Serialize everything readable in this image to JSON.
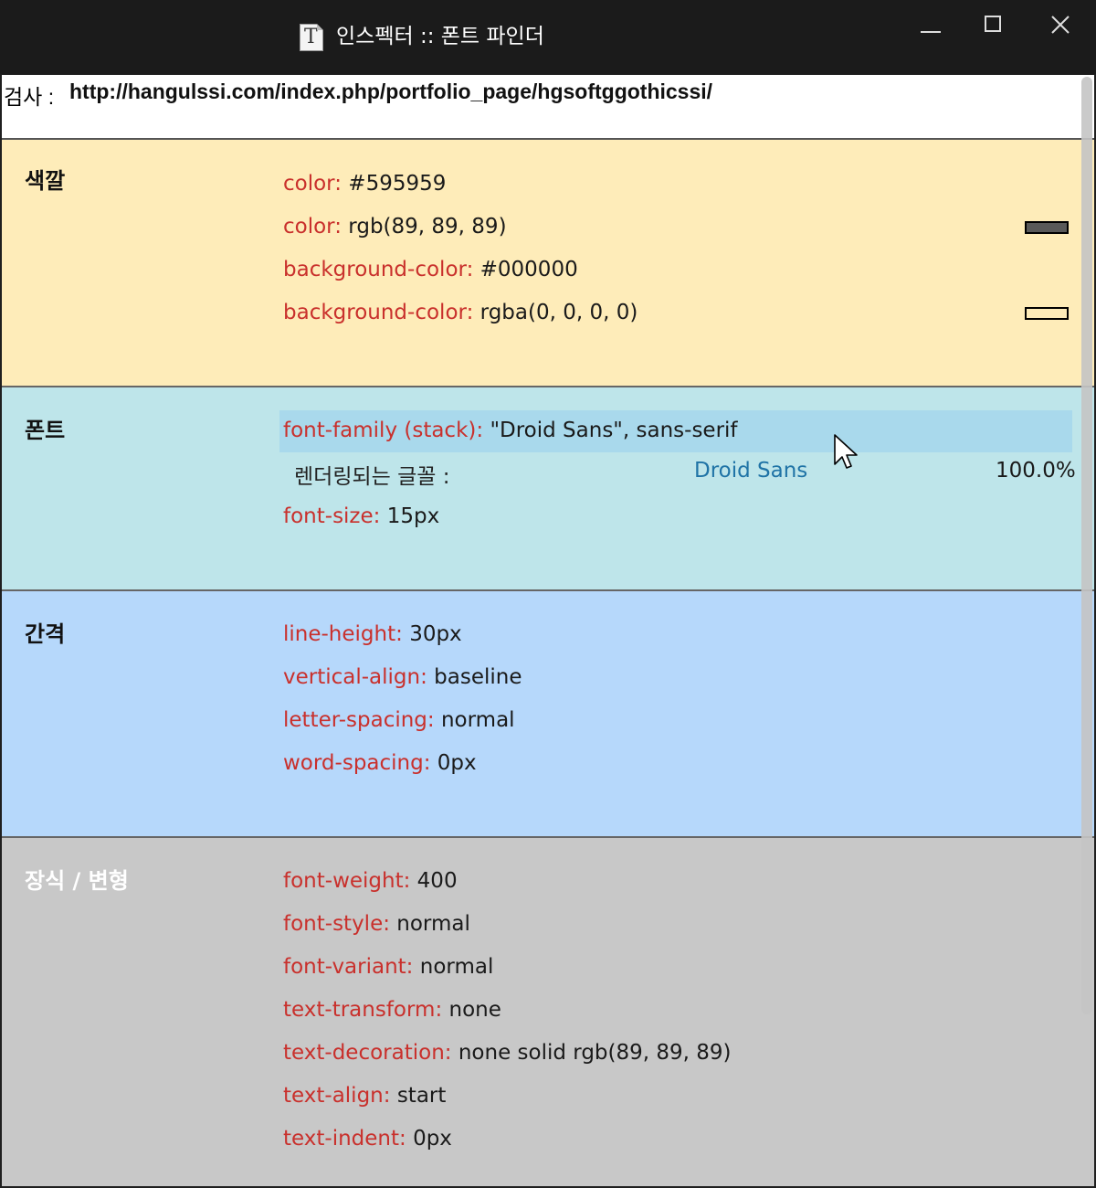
{
  "window": {
    "title": "인스펙터 :: 폰트 파인더",
    "icon": "document-font-icon",
    "controls": [
      "minimize-icon",
      "maximize-icon",
      "close-icon"
    ]
  },
  "inspect": {
    "label": "검사 :",
    "url": "http://hangulssi.com/index.php/portfolio_page/hgsoftggothicssi/"
  },
  "sections": {
    "color": {
      "title": "색깔",
      "props": [
        {
          "k": "color:",
          "v": "#595959"
        },
        {
          "k": "color:",
          "v": "rgb(89, 89, 89)",
          "swatch": "#595959"
        },
        {
          "k": "background-color:",
          "v": "#000000"
        },
        {
          "k": "background-color:",
          "v": "rgba(0, 0, 0, 0)",
          "swatch": "transparent"
        }
      ]
    },
    "font": {
      "title": "폰트",
      "stack_key": "font-family (stack):",
      "stack_value": "\"Droid Sans\", sans-serif",
      "rendered_label": "렌더링되는 글꼴 :",
      "rendered_font": "Droid Sans",
      "rendered_pct": "100.0%",
      "size_key": "font-size:",
      "size_value": "15px"
    },
    "spacing": {
      "title": "간격",
      "props": [
        {
          "k": "line-height:",
          "v": "30px"
        },
        {
          "k": "vertical-align:",
          "v": "baseline"
        },
        {
          "k": "letter-spacing:",
          "v": "normal"
        },
        {
          "k": "word-spacing:",
          "v": "0px"
        }
      ]
    },
    "decoration": {
      "title": "장식 / 변형",
      "props": [
        {
          "k": "font-weight:",
          "v": "400"
        },
        {
          "k": "font-style:",
          "v": "normal"
        },
        {
          "k": "font-variant:",
          "v": "normal"
        },
        {
          "k": "text-transform:",
          "v": "none"
        },
        {
          "k": "text-decoration:",
          "v": "none solid rgb(89, 89, 89)"
        },
        {
          "k": "text-align:",
          "v": "start"
        },
        {
          "k": "text-indent:",
          "v": "0px"
        }
      ]
    }
  },
  "colors": {
    "color_section_bg": "#feecb9",
    "font_section_bg": "#bee5ea",
    "spacing_section_bg": "#b6d8fb",
    "decoration_section_bg": "#c8c8c8",
    "property_key": "#c9302c",
    "rendered_font": "#1f73a6"
  }
}
